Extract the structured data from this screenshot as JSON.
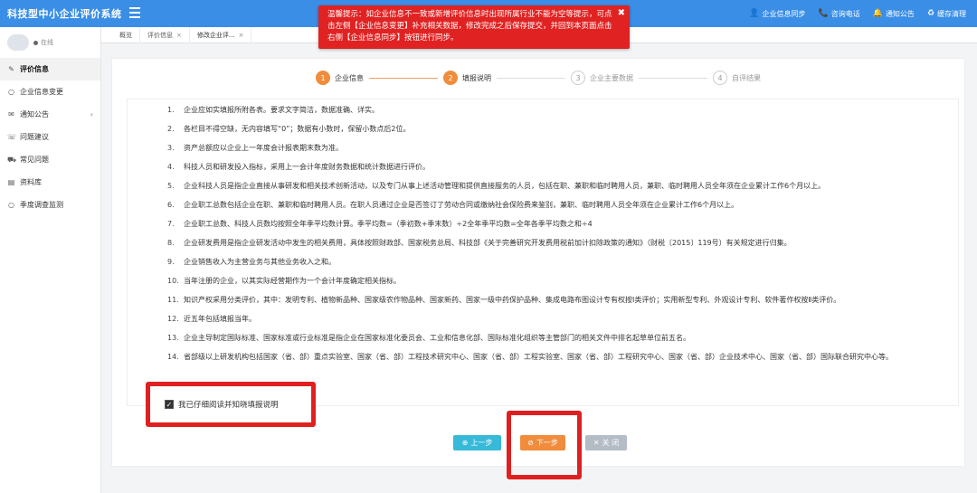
{
  "app": {
    "title": "科技型中小企业评价系统"
  },
  "topnav": [
    {
      "icon": "user-icon",
      "label": "企业信息同步"
    },
    {
      "icon": "phone-icon",
      "label": "咨询电话"
    },
    {
      "icon": "bell-icon",
      "label": "通知公告"
    },
    {
      "icon": "cache-clear-icon",
      "label": "缓存清理"
    }
  ],
  "warning": {
    "text": "温馨提示：如企业信息不一致或新增评价信息时出现所属行业不能为空等提示，可点击左侧【企业信息变更】补充相关数据，修改完成之后保存提交，并回到本页面点击右侧【企业信息同步】按钮进行同步。",
    "color": "#e02222"
  },
  "sidebar": {
    "status": "在线",
    "items": [
      {
        "label": "评价信息",
        "icon": "edit-icon",
        "active": true
      },
      {
        "label": "企业信息变更",
        "icon": "circle-icon"
      },
      {
        "label": "通知公告",
        "icon": "envelope-icon",
        "chevron": "‹"
      },
      {
        "label": "问题建议",
        "icon": "chat-icon"
      },
      {
        "label": "常见问题",
        "icon": "car-icon"
      },
      {
        "label": "资料库",
        "icon": "folder-icon"
      },
      {
        "label": "季度调查监测",
        "icon": "circle-icon"
      }
    ]
  },
  "tabs": [
    {
      "label": "概览"
    },
    {
      "label": "评价信息",
      "close": "×"
    },
    {
      "label": "修改企业评...",
      "close": "×"
    }
  ],
  "steps": [
    {
      "num": "1",
      "label": "企业信息",
      "done": true
    },
    {
      "num": "2",
      "label": "填报说明",
      "done": true
    },
    {
      "num": "3",
      "label": "企业主要数据",
      "done": false
    },
    {
      "num": "4",
      "label": "自评结果",
      "done": false
    }
  ],
  "notes": [
    {
      "n": "1.",
      "text": "企业应如实填报所附各表。要求文字简洁，数据准确、详实。"
    },
    {
      "n": "2.",
      "text": "各栏目不得空缺，无内容填写“0”；数据有小数时，保留小数点后2位。"
    },
    {
      "n": "3.",
      "text": "资产总额应以企业上一年度会计报表期末数为准。"
    },
    {
      "n": "4.",
      "text": "科技人员和研发投入指标，采用上一会计年度财务数据和统计数据进行评价。"
    },
    {
      "n": "5.",
      "text": "企业科技人员是指企业直接从事研发和相关技术创新活动，以及专门从事上述活动管理和提供直接服务的人员，包括在职、兼职和临时聘用人员，兼职、临时聘用人员全年须在企业累计工作6个月以上。"
    },
    {
      "n": "6.",
      "text": "企业职工总数包括企业在职、兼职和临时聘用人员。在职人员通过企业是否签订了劳动合同或缴纳社会保险费来鉴别，兼职、临时聘用人员全年须在企业累计工作6个月以上。"
    },
    {
      "n": "7.",
      "text": "企业职工总数、科技人员数均按照全年季平均数计算。季平均数=（季初数+季末数）÷2全年季平均数=全年各季平均数之和÷4"
    },
    {
      "n": "8.",
      "text": "企业研发费用是指企业研发活动中发生的相关费用，具体按照财政部、国家税务总局、科技部《关于完善研究开发费用税前加计扣除政策的通知》（财税〔2015〕119号）有关规定进行归集。"
    },
    {
      "n": "9.",
      "text": "企业销售收入为主营业务与其他业务收入之和。"
    },
    {
      "n": "10.",
      "text": "当年注册的企业，以其实际经营期作为一个会计年度确定相关指标。"
    },
    {
      "n": "11.",
      "text": "知识产权采用分类评价，其中：发明专利、植物新品种、国家级农作物品种、国家新药、国家一级中药保护品种、集成电路布图设计专有权按Ⅰ类评价；实用新型专利、外观设计专利、软件著作权按Ⅱ类评价。"
    },
    {
      "n": "12.",
      "text": "近五年包括填报当年。"
    },
    {
      "n": "13.",
      "text": "企业主导制定国际标准、国家标准或行业标准是指企业在国家标准化委员会、工业和信息化部、国际标准化组织等主管部门的相关文件中排名起草单位前五名。"
    },
    {
      "n": "14.",
      "text": "省部级以上研发机构包括国家（省、部）重点实验室、国家（省、部）工程技术研究中心、国家（省、部）工程实验室、国家（省、部）工程研究中心、国家（省、部）企业技术中心、国家（省、部）国际联合研究中心等。"
    }
  ],
  "agree": {
    "label": "我已仔细阅读并知晓填报说明",
    "checked": true
  },
  "buttons": {
    "prev": {
      "icon": "⊕",
      "label": "上一步"
    },
    "next": {
      "icon": "⊘",
      "label": "下一步"
    },
    "close": {
      "icon": "✕",
      "label": "关 闭"
    }
  },
  "colors": {
    "header": "#3a8ee6",
    "step_done": "#f08c3c",
    "prev_button": "#37b9d8",
    "next_button": "#f08c3c",
    "close_button": "#b4bcc6",
    "highlight": "#e02020"
  }
}
